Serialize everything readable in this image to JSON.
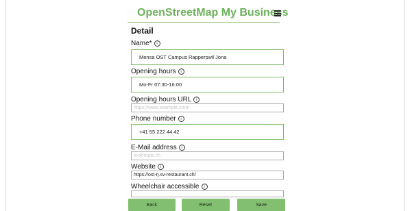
{
  "header": {
    "title": "OpenStreetMap My Business",
    "menu_icon": "hamburger-menu-icon"
  },
  "detail": {
    "title": "Detail"
  },
  "fields": {
    "name": {
      "label": "Name*",
      "value": "Mensa OST Campus Rapperswil Jona"
    },
    "opening_hours": {
      "label": "Opening hours",
      "value": "Mo-Fr 07:30-16:00"
    },
    "opening_hours_url": {
      "label": "Opening hours URL",
      "placeholder": "https://www.example.com/"
    },
    "phone": {
      "label": "Phone number",
      "value": "+41 55 222 44 42"
    },
    "email": {
      "label": "E-Mail address",
      "placeholder": "ex@mple.ch"
    },
    "website": {
      "label": "Website",
      "value": "https://ost-rj.sv-restaurant.ch/"
    },
    "wheelchair": {
      "label": "Wheelchair accessible"
    }
  },
  "info_icon": "info-circle-icon",
  "info_glyph": "i",
  "buttons": {
    "back": "Back",
    "reset": "Reset",
    "save": "Save"
  },
  "colors": {
    "accent": "#6cb15a",
    "button": "#83bf70",
    "field_border": "#7cbd64"
  }
}
